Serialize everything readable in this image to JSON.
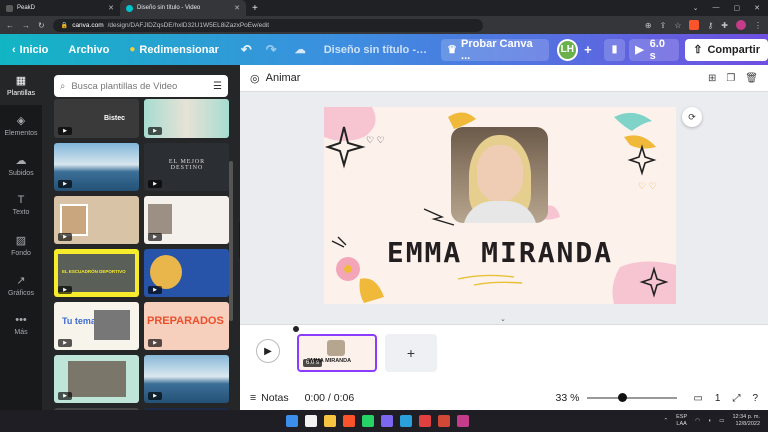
{
  "browser": {
    "tabs": [
      {
        "title": "PeakD",
        "active": false
      },
      {
        "title": "Diseño sin título - Video",
        "active": true
      }
    ],
    "new_tab": "+",
    "url_domain": "canva.com",
    "url_path": "/design/DAFJlDZqsDE/hxlD32U1W5EL8iZazxPoEw/edit"
  },
  "toolbar": {
    "home": "Inicio",
    "file": "Archivo",
    "resize": "Redimensionar",
    "title": "Diseño sin título - Vi...",
    "try_canva": "Probar Canva ...",
    "avatar": "LH",
    "duration": "6.0 s",
    "share": "Compartir"
  },
  "rail": {
    "items": [
      {
        "label": "Plantillas",
        "icon": "templates-icon",
        "active": true
      },
      {
        "label": "Elementos",
        "icon": "elements-icon",
        "active": false
      },
      {
        "label": "Subidos",
        "icon": "upload-icon",
        "active": false
      },
      {
        "label": "Texto",
        "icon": "text-icon",
        "active": false
      },
      {
        "label": "Fondo",
        "icon": "background-icon",
        "active": false
      },
      {
        "label": "Gráficos",
        "icon": "charts-icon",
        "active": false
      },
      {
        "label": "Más",
        "icon": "more-icon",
        "active": false
      }
    ]
  },
  "panel": {
    "search_placeholder": "Busca plantillas de Video",
    "thumb_texts": {
      "bistec": "Bistec",
      "mejor_destino": "EL MEJOR DESTINO",
      "escuadron": "EL ESCUADRÓN DEPORTIVO",
      "tu_tema": "Tu tema",
      "preparados": "PREPARADOS"
    }
  },
  "editor": {
    "animate": "Animar",
    "canvas_name": "EMMA MIRANDA",
    "clip_duration": "6.0 s",
    "clip_name": "EMMA MIRANDA"
  },
  "bottom": {
    "notes": "Notas",
    "time": "0:00 / 0:06",
    "zoom": "33 %",
    "page": "1"
  },
  "taskbar": {
    "lang_top": "ESP",
    "lang_bottom": "LAA",
    "time": "12:34 p. m.",
    "date": "12/8/2022"
  },
  "colors": {
    "accent": "#8b3dff",
    "gradient_start": "#12b5c4",
    "gradient_end": "#6f4fe0"
  }
}
